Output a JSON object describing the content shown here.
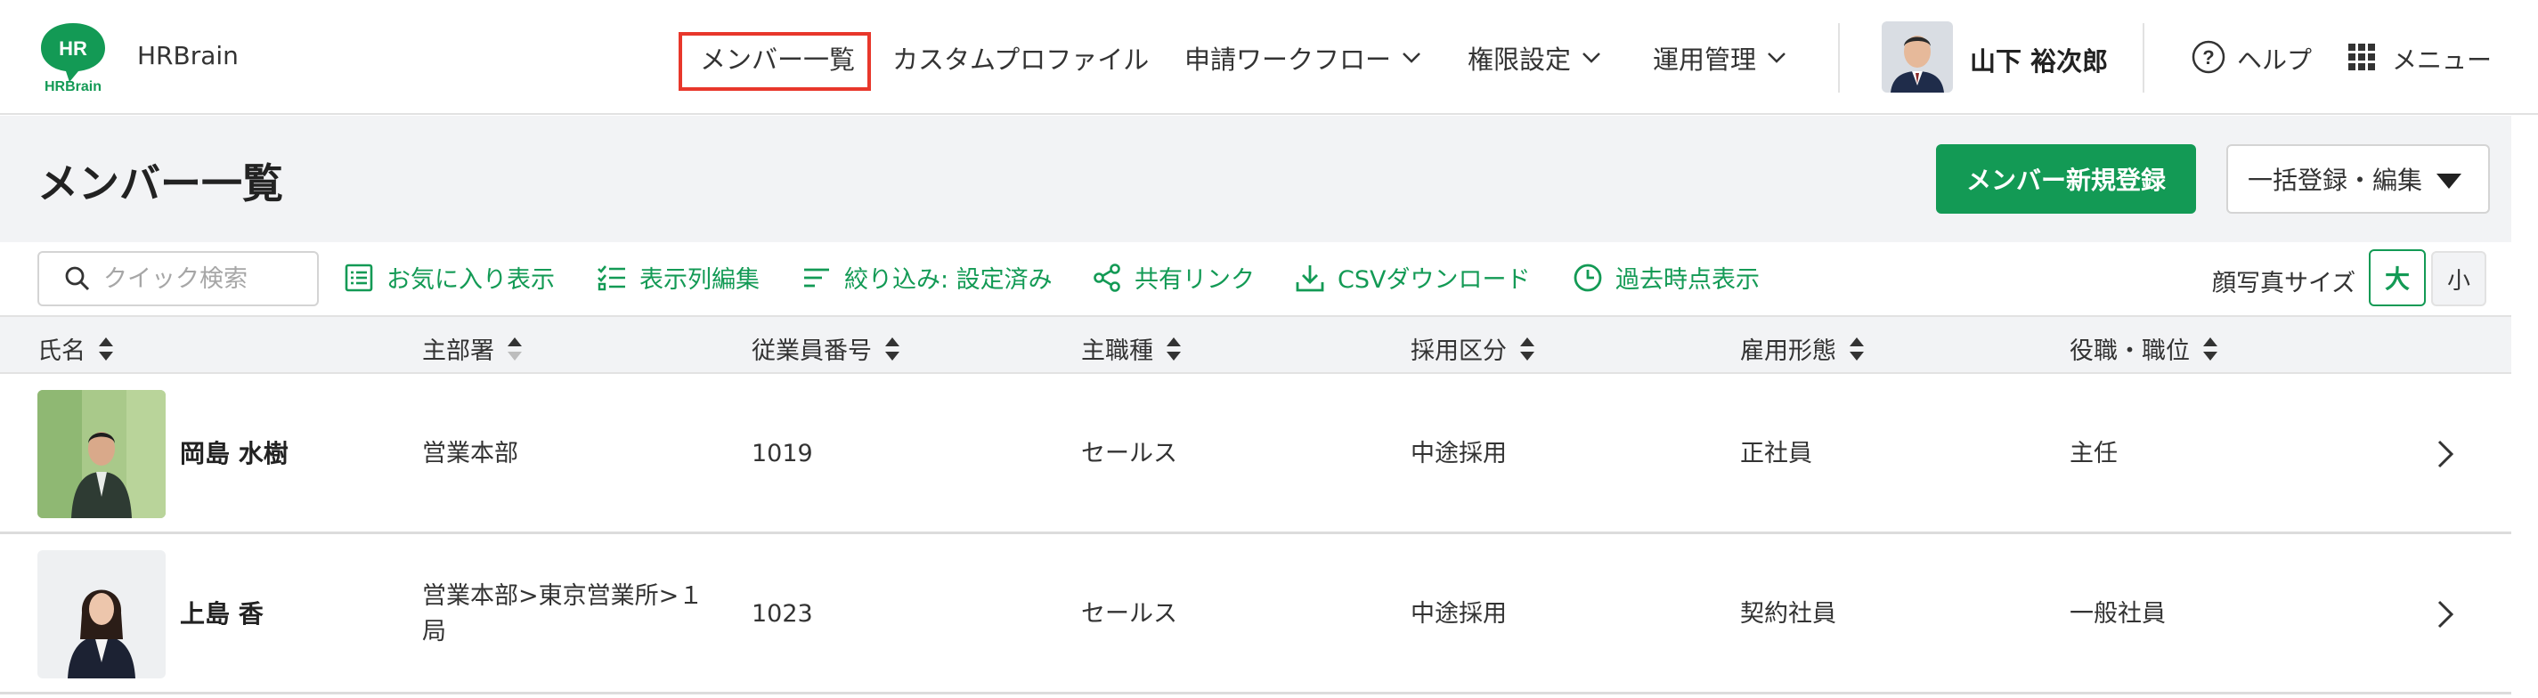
{
  "header": {
    "logo_text_top": "HR",
    "logo_text_bottom": "HRBrain",
    "brand": "HRBrain",
    "nav": [
      {
        "label": "メンバー一覧",
        "active": true,
        "dropdown": false
      },
      {
        "label": "カスタムプロファイル",
        "active": false,
        "dropdown": false
      },
      {
        "label": "申請ワークフロー",
        "active": false,
        "dropdown": true
      },
      {
        "label": "権限設定",
        "active": false,
        "dropdown": true
      },
      {
        "label": "運用管理",
        "active": false,
        "dropdown": true
      }
    ],
    "user_name": "山下 裕次郎",
    "help_label": "ヘルプ",
    "menu_label": "メニュー"
  },
  "title_bar": {
    "title": "メンバー一覧",
    "primary_button": "メンバー新規登録",
    "secondary_button": "一括登録・編集"
  },
  "toolbar": {
    "search_placeholder": "クイック検索",
    "tools": [
      {
        "icon": "favorites-list-icon",
        "label": "お気に入り表示"
      },
      {
        "icon": "column-edit-icon",
        "label": "表示列編集"
      },
      {
        "icon": "filter-icon",
        "label": "絞り込み: 設定済み"
      },
      {
        "icon": "share-icon",
        "label": "共有リンク"
      },
      {
        "icon": "download-icon",
        "label": "CSVダウンロード"
      },
      {
        "icon": "clock-icon",
        "label": "過去時点表示"
      }
    ],
    "face_size_label": "顔写真サイズ",
    "size_large": "大",
    "size_small": "小"
  },
  "table": {
    "columns": [
      "氏名",
      "主部署",
      "従業員番号",
      "主職種",
      "採用区分",
      "雇用形態",
      "役職・職位"
    ],
    "rows": [
      {
        "name": "岡島 水樹",
        "department_lines": [
          "営業本部"
        ],
        "employee_no": "1019",
        "job": "セールス",
        "hiring": "中途採用",
        "employment": "正社員",
        "position": "主任"
      },
      {
        "name": "上島 香",
        "department_lines": [
          "営業本部>東京営業所>１",
          "局"
        ],
        "employee_no": "1023",
        "job": "セールス",
        "hiring": "中途採用",
        "employment": "契約社員",
        "position": "一般社員"
      }
    ]
  },
  "colors": {
    "accent": "#139a55",
    "active_outline": "#e8372b",
    "background": "#f2f3f5"
  }
}
